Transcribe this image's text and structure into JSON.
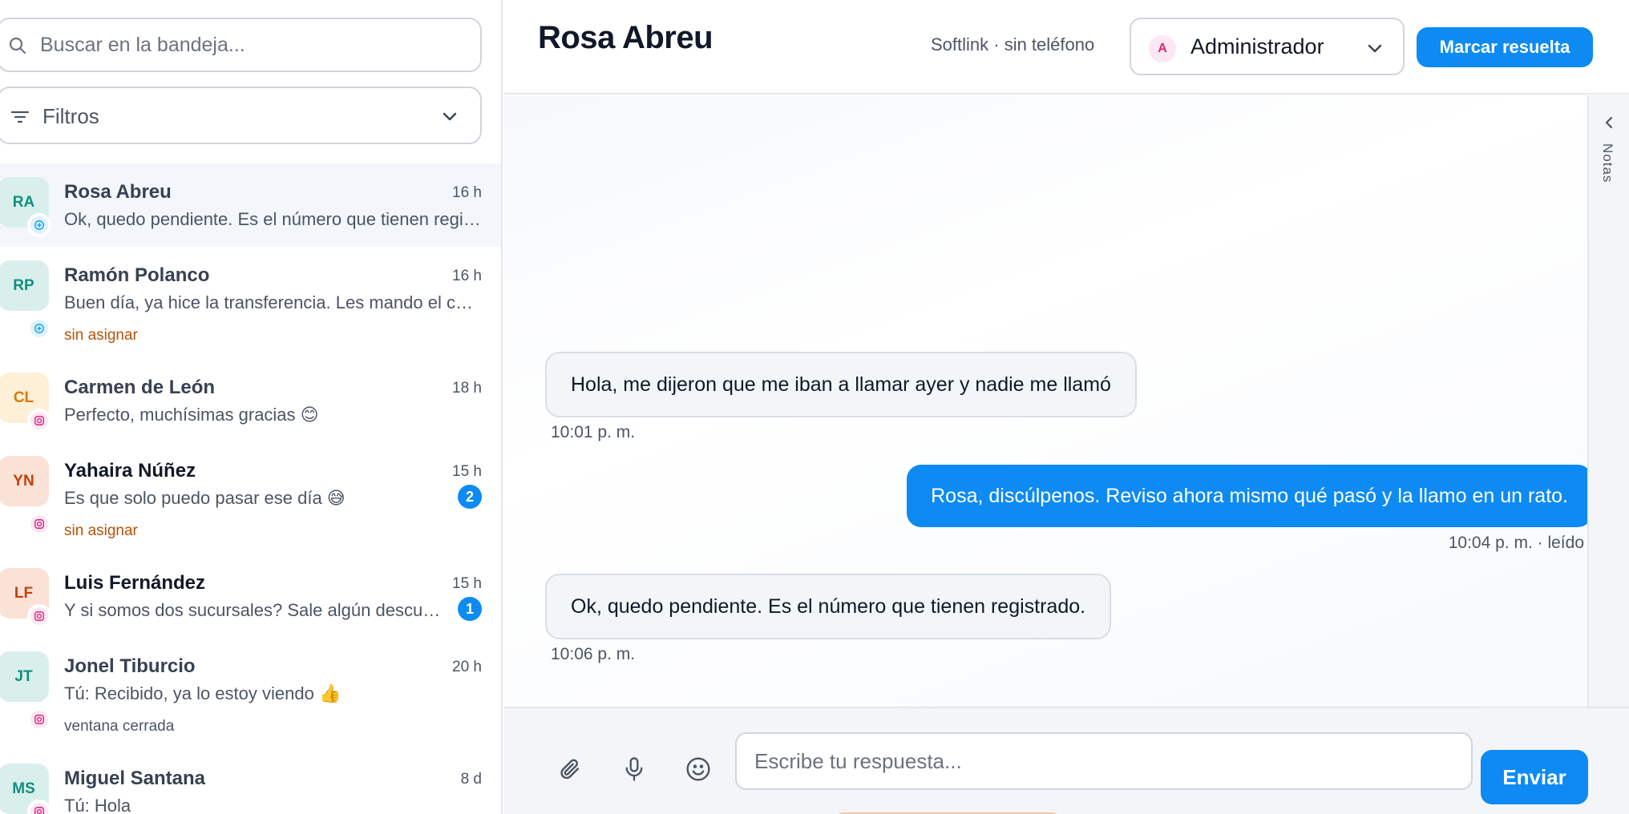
{
  "search": {
    "placeholder": "Buscar en la bandeja..."
  },
  "filters": {
    "label": "Filtros"
  },
  "conversations": [
    {
      "initials": "RA",
      "name": "Rosa Abreu",
      "time": "16 h",
      "preview": "Ok, quedo pendiente. Es el número que tienen registrado.",
      "channel": "chat",
      "tag": "",
      "unread": null,
      "active": true,
      "avatar_bg": "#d9efec",
      "avatar_fg": "#0f8f7e"
    },
    {
      "initials": "RP",
      "name": "Ramón Polanco",
      "time": "16 h",
      "preview": "Buen día, ya hice la transferencia. Les mando el comprobante.",
      "channel": "chat",
      "tag": "sin asignar",
      "unread": null,
      "active": false,
      "avatar_bg": "#d9efec",
      "avatar_fg": "#0f8f7e"
    },
    {
      "initials": "CL",
      "name": "Carmen de León",
      "time": "18 h",
      "preview": "Perfecto, muchísimas gracias 😊",
      "channel": "instagram",
      "tag": "",
      "unread": null,
      "active": false,
      "avatar_bg": "#fdf0d7",
      "avatar_fg": "#d97706"
    },
    {
      "initials": "YN",
      "name": "Yahaira Núñez",
      "time": "15 h",
      "preview": "Es que solo puedo pasar ese día 😅",
      "channel": "instagram",
      "tag": "sin asignar",
      "unread": "2",
      "active": false,
      "avatar_bg": "#fbe2d6",
      "avatar_fg": "#c2410c"
    },
    {
      "initials": "LF",
      "name": "Luis Fernández",
      "time": "15 h",
      "preview": "Y si somos dos sucursales? Sale algún descuento?",
      "channel": "instagram",
      "tag": "",
      "unread": "1",
      "active": false,
      "avatar_bg": "#fbe2d6",
      "avatar_fg": "#c2410c"
    },
    {
      "initials": "JT",
      "name": "Jonel Tiburcio",
      "time": "20 h",
      "preview": "Tú: Recibido, ya lo estoy viendo 👍",
      "channel": "instagram",
      "tag": "ventana cerrada",
      "unread": null,
      "active": false,
      "avatar_bg": "#d9efec",
      "avatar_fg": "#0f8f7e"
    },
    {
      "initials": "MS",
      "name": "Miguel Santana",
      "time": "8 d",
      "preview": "Tú: Hola",
      "channel": "instagram",
      "tag": "",
      "unread": null,
      "active": false,
      "avatar_bg": "#d9efec",
      "avatar_fg": "#0f8f7e"
    }
  ],
  "header": {
    "title": "Rosa Abreu",
    "meta": "Softlink · sin teléfono",
    "assignee_initial": "A",
    "assignee_name": "Administrador",
    "resolve_label": "Marcar resuelta"
  },
  "messages": [
    {
      "direction": "in",
      "text": "Hola, me dijeron que me iban a llamar ayer y nadie me llamó",
      "time": "10:01 p. m."
    },
    {
      "direction": "out",
      "text": "Rosa, discúlpenos. Reviso ahora mismo qué pasó y la llamo en un rato.",
      "time": "10:04 p. m.  · leído"
    },
    {
      "direction": "in",
      "text": "Ok, quedo pendiente. Es el número que tienen registrado.",
      "time": "10:06 p. m."
    }
  ],
  "notes": {
    "label": "Notas"
  },
  "composer": {
    "placeholder": "Escribe tu respuesta...",
    "send_label": "Enviar"
  },
  "colors": {
    "accent": "#0d8bf2",
    "tag_unassigned": "#b45309",
    "tag_closed": "#4b5563",
    "chat_channel": "#0ea5e9",
    "instagram_channel": "#db2777"
  }
}
